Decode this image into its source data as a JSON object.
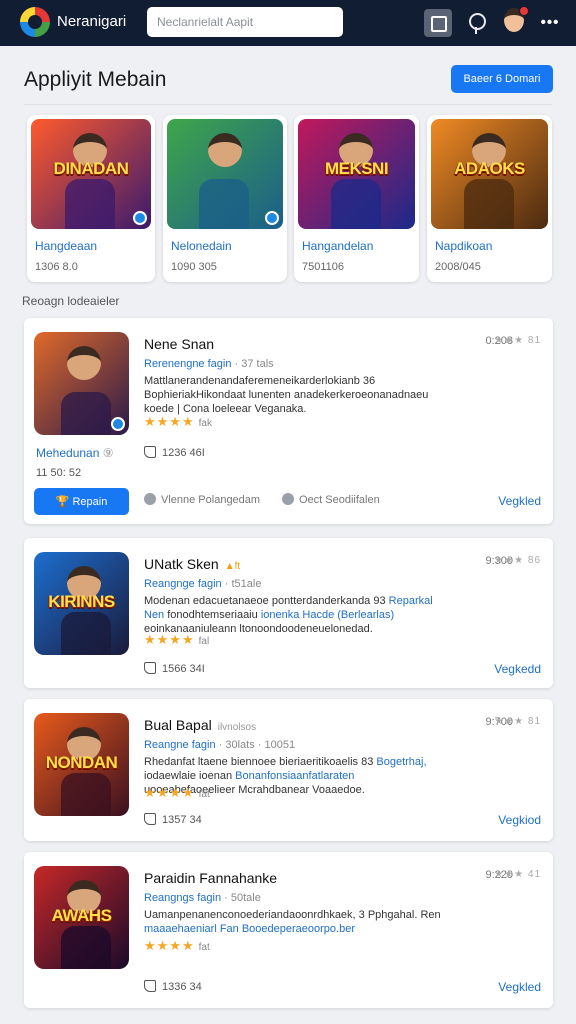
{
  "topbar": {
    "app_name": "Neranigari",
    "search_placeholder": "Neclanrielalt Aapit",
    "icons": [
      "logo-icon",
      "edit-icon",
      "bulb-icon",
      "avatar",
      "more-icon"
    ]
  },
  "header": {
    "title": "Appliyit Mebain",
    "action_label": "Baeer 6 Domari"
  },
  "featured": [
    {
      "art": "DINADAN",
      "title": "Hangdeaan",
      "meta": "1306 8.0",
      "colors": [
        "#ff5a2c",
        "#3a1a6e"
      ]
    },
    {
      "art": "",
      "title": "Nelonedain",
      "meta": "1090 305",
      "colors": [
        "#3fa64a",
        "#1b5e8a"
      ]
    },
    {
      "art": "MEKSNI",
      "title": "Hangandelan",
      "meta": "7501106",
      "colors": [
        "#c2185b",
        "#1a2a8a"
      ]
    },
    {
      "art": "ADAOKS",
      "title": "Napdikoan",
      "meta": "2008/045",
      "colors": [
        "#f08a24",
        "#4a2a10"
      ]
    }
  ],
  "section_label": "Reoagn lodeaieler",
  "list": [
    {
      "title": "Nene Snan",
      "tag": "",
      "subtitle": "",
      "time": "0:203",
      "stars_meta": "★★★ 81",
      "category": "Rerenengne fagin",
      "category_meta": "· 37 tals",
      "desc": [
        {
          "t": "Mattlanerandenandaferemeneikarderlokianb 36 Bophieriak"
        },
        {
          "t": "Hikondaat lunenten anadekerkeroeon"
        },
        {
          "t": "anadnaeu koede | Cona loeleear Veganaka."
        }
      ],
      "rating_stars": "★★★★",
      "rating_count": "fak",
      "likes": "1236 46I",
      "extra_label": "Mehedunan",
      "extra_icon": "help-icon",
      "extra_meta": "11 50: 52",
      "repair_label": "Repain",
      "repair_icon": "trophy-icon",
      "mini_links": [
        "Vlenne Polangedam",
        "Oect Seodiifalen"
      ],
      "link": "Vegkled",
      "art": "",
      "colors": [
        "#e06a2a",
        "#2a1a4a"
      ]
    },
    {
      "title": "UNatk Sken",
      "tag": "▲ft",
      "subtitle": "",
      "time": "9:300",
      "stars_meta": "★★★ 86",
      "category": "Reangnge fagin",
      "category_meta": "· t51ale",
      "desc": [
        {
          "t": "Modenan edacuetanaeoe pontterdanderkanda 93 "
        },
        {
          "t": "Reparkal Nen",
          "hl": true
        },
        {
          "t": " fonodhtemseriaaiu "
        },
        {
          "t": "ionenka Hacde (Berlearlas)",
          "hl": true
        },
        {
          "t": " eoinkanaaniuleann ltonoondoodeneuelonedad."
        }
      ],
      "rating_stars": "★★★★",
      "rating_count": "fal",
      "likes": "1566 34I",
      "link": "Vegkedd",
      "art": "KIRINNS",
      "colors": [
        "#1d6fd0",
        "#1a1a3a"
      ]
    },
    {
      "title": "Bual Bapal",
      "tag": "",
      "subtitle": "ilvnolsos",
      "time": "9:700",
      "stars_meta": "★★★ 81",
      "category": "Reangne fagin",
      "category_meta": "· 30lats · 10051",
      "desc": [
        {
          "t": "Rhedanfat ltaene biennoee bieriaeritikoaelis 83 "
        },
        {
          "t": "Bogetrhaj,",
          "hl": true
        },
        {
          "t": " iodaewlaie ioenan "
        },
        {
          "t": "Bonanfonsiaanfatlaraten",
          "hl": true
        },
        {
          "t": " uooeabefaoeelieer Mcrahdbanear Voaaedoe."
        }
      ],
      "rating_stars": "★★★★",
      "rating_count": "fat",
      "likes": "1357 34",
      "link": "Vegkiod",
      "art": "NONDAN",
      "colors": [
        "#e85a1c",
        "#3a1020"
      ]
    },
    {
      "title": "Paraidin Fannahanke",
      "tag": "",
      "subtitle": "",
      "time": "9:220",
      "stars_meta": "★★★ 41",
      "category": "Reangngs fagin",
      "category_meta": "· 50tale",
      "desc": [
        {
          "t": "Uamanpenanenconoederiandaoonrdhkaek, 3 Pphgahal. Ren "
        },
        {
          "t": "maaaehaeniarl Fan Booedeperaeoorpo.ber",
          "hl": true
        }
      ],
      "rating_stars": "★★★★",
      "rating_count": "fat",
      "likes": "1336 34",
      "link": "Vegkled",
      "art": "AWAHS",
      "colors": [
        "#c62828",
        "#1a0a2a"
      ]
    }
  ]
}
